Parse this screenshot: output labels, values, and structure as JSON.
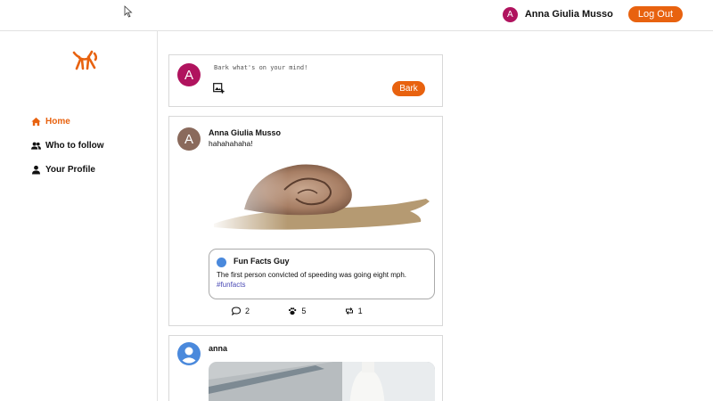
{
  "header": {
    "user_initial": "A",
    "user_name": "Anna Giulia Musso",
    "logout_label": "Log Out"
  },
  "sidebar": {
    "items": [
      {
        "label": "Home",
        "icon": "home-icon",
        "active": true
      },
      {
        "label": "Who to follow",
        "icon": "people-icon",
        "active": false
      },
      {
        "label": "Your Profile",
        "icon": "person-icon",
        "active": false
      }
    ]
  },
  "composer": {
    "avatar_initial": "A",
    "placeholder": "Bark what's on your mind!",
    "submit_label": "Bark"
  },
  "posts": [
    {
      "avatar_initial": "A",
      "author": "Anna Giulia Musso",
      "text": "hahahahaha!",
      "quote": {
        "author": "Fun Facts Guy",
        "text": "The first person convicted of speeding was going eight mph.",
        "tag": "#funfacts"
      },
      "comments": "2",
      "paws": "5",
      "rebarks": "1"
    },
    {
      "author": "anna"
    }
  ],
  "colors": {
    "accent": "#e8620f",
    "avatar_magenta": "#b0135e",
    "avatar_brown": "#8a6a5c",
    "avatar_blue": "#4a89dc"
  }
}
